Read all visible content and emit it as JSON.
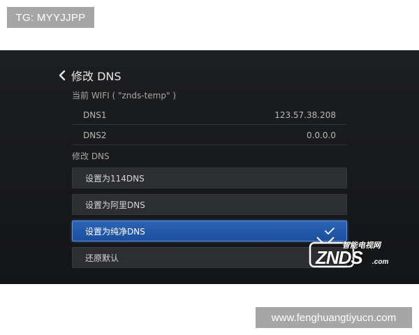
{
  "watermark_top": "TG: MYYJJPP",
  "watermark_bottom": "www.fenghuangtiyucn.com",
  "header": {
    "title": "修改 DNS",
    "back_icon": "chevron-left-icon"
  },
  "wifi_info": "当前 WIFI ( \"znds-temp\" )",
  "dns_rows": [
    {
      "label": "DNS1",
      "value": "123.57.38.208"
    },
    {
      "label": "DNS2",
      "value": "0.0.0.0"
    }
  ],
  "section_label": "修改 DNS",
  "options": [
    {
      "label": "设置为114DNS",
      "selected": false
    },
    {
      "label": "设置为阿里DNS",
      "selected": false
    },
    {
      "label": "设置为纯净DNS",
      "selected": true
    },
    {
      "label": "还原默认",
      "selected": false
    }
  ],
  "logo": {
    "text": "ZNDS",
    "suffix": ".com",
    "tagline": "智能电视网"
  },
  "colors": {
    "screen_bg": "#1a1b1d",
    "selected": "#2c63b4",
    "selected_border": "#5f95e3"
  }
}
